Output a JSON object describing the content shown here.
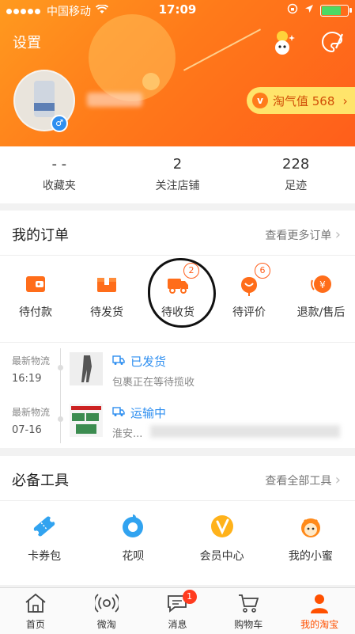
{
  "status_bar": {
    "carrier": "中国移动",
    "time": "17:09"
  },
  "header": {
    "settings_label": "设置",
    "points_label": "淘气值 568",
    "points_icon": "v-badge-icon",
    "colors": {
      "gradient_start": "#ff9a1f",
      "gradient_end": "#ff5e1b"
    }
  },
  "stats": [
    {
      "value": "- -",
      "label": "收藏夹"
    },
    {
      "value": "2",
      "label": "关注店铺"
    },
    {
      "value": "228",
      "label": "足迹"
    }
  ],
  "orders": {
    "title": "我的订单",
    "more_label": "查看更多订单",
    "items": [
      {
        "label": "待付款",
        "icon": "wallet-icon"
      },
      {
        "label": "待发货",
        "icon": "package-icon"
      },
      {
        "label": "待收货",
        "icon": "truck-icon",
        "badge": "2"
      },
      {
        "label": "待评价",
        "icon": "flower-icon",
        "badge": "6"
      },
      {
        "label": "退款/售后",
        "icon": "refund-icon"
      }
    ],
    "logistics": [
      {
        "key_label": "最新物流",
        "time": "16:19",
        "status": "已发货",
        "desc": "包裹正在等待揽收"
      },
      {
        "key_label": "最新物流",
        "time": "07-16",
        "status": "运输中",
        "desc": "淮安..."
      }
    ]
  },
  "tools": {
    "title": "必备工具",
    "more_label": "查看全部工具",
    "items": [
      {
        "label": "卡券包",
        "icon": "ticket-icon"
      },
      {
        "label": "花呗",
        "icon": "huabei-icon"
      },
      {
        "label": "会员中心",
        "icon": "vip-icon"
      },
      {
        "label": "我的小蜜",
        "icon": "assistant-icon"
      }
    ]
  },
  "tabbar": [
    {
      "label": "首页",
      "icon": "home-icon"
    },
    {
      "label": "微淘",
      "icon": "broadcast-icon"
    },
    {
      "label": "消息",
      "icon": "message-icon",
      "badge": "1"
    },
    {
      "label": "购物车",
      "icon": "cart-icon"
    },
    {
      "label": "我的淘宝",
      "icon": "profile-icon",
      "active": true
    }
  ]
}
